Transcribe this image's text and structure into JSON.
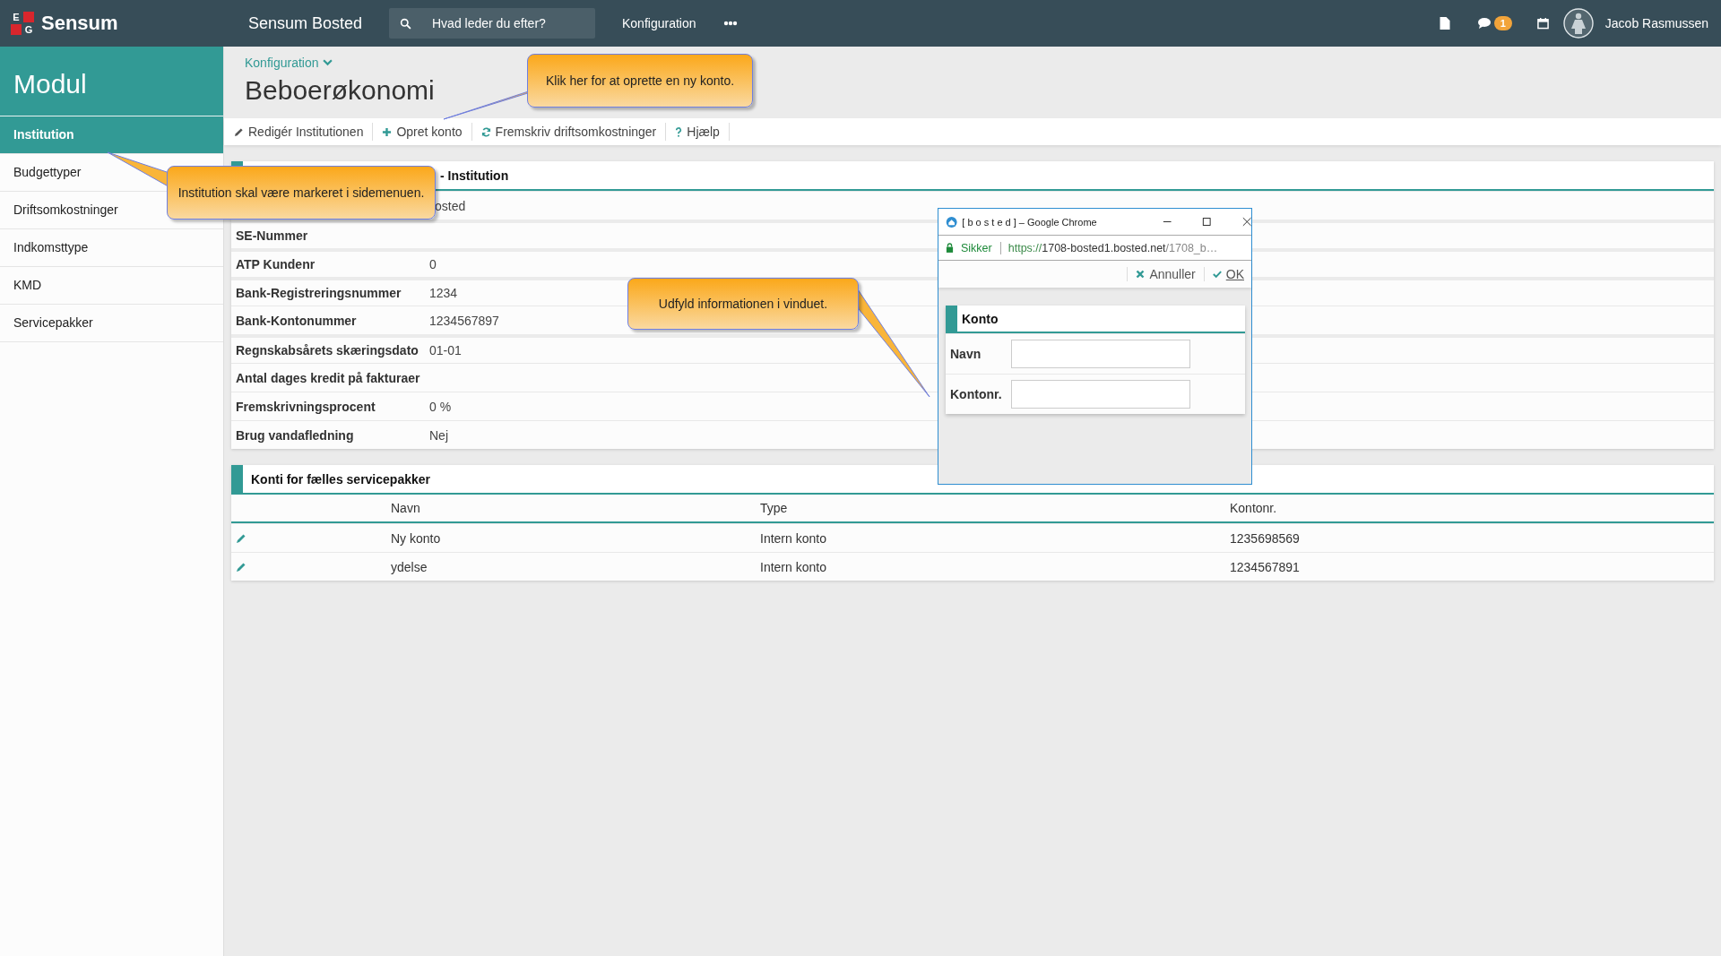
{
  "topbar": {
    "logo": {
      "letters": [
        "E",
        "G"
      ],
      "name": "Sensum"
    },
    "app_title": "Sensum Bosted",
    "search": {
      "placeholder": "Hvad leder du efter?"
    },
    "menu": "Konfiguration",
    "messages_badge": "1",
    "user": "Jacob Rasmussen"
  },
  "sidebar": {
    "title": "Modul",
    "items": [
      {
        "label": "Institution",
        "selected": true
      },
      {
        "label": "Budgettyper",
        "selected": false
      },
      {
        "label": "Driftsomkostninger",
        "selected": false
      },
      {
        "label": "Indkomsttype",
        "selected": false
      },
      {
        "label": "KMD",
        "selected": false
      },
      {
        "label": "Servicepakker",
        "selected": false
      }
    ]
  },
  "breadcrumb": "Konfiguration",
  "page_title": "Beboerøkonomi",
  "toolbar": [
    {
      "kind": "edit",
      "label": "Redigér Institutionen"
    },
    {
      "kind": "add",
      "label": "Opret konto"
    },
    {
      "kind": "refresh",
      "label": "Fremskriv driftsomkostninger"
    },
    {
      "kind": "help",
      "label": "Hjælp"
    }
  ],
  "details": {
    "title": "- Institution",
    "rows": [
      {
        "value": "osted"
      },
      {
        "label": "SE-Nummer"
      },
      {
        "label": "ATP Kundenr",
        "value": "0"
      },
      {
        "label": "Bank-Registreringsnummer",
        "value": "1234"
      },
      {
        "label": "Bank-Kontonummer",
        "value": "1234567897"
      },
      {
        "label": "Regnskabsårets skæringsdato",
        "value": "01-01"
      },
      {
        "label": "Antal dages kredit på fakturaer"
      },
      {
        "label": "Fremskrivningsprocent",
        "value": "0 %"
      },
      {
        "label": "Brug vandafledning",
        "value": "Nej"
      }
    ]
  },
  "accounts": {
    "title": "Konti for fælles servicepakker",
    "columns": [
      "Navn",
      "Type",
      "Kontonr."
    ],
    "rows": [
      [
        "Ny konto",
        "Intern konto",
        "1235698569"
      ],
      [
        "ydelse",
        "Intern konto",
        "1234567891"
      ]
    ]
  },
  "popup": {
    "window_title": "[ b o s t e d ] – Google Chrome",
    "security": "Sikker",
    "url_scheme": "https://",
    "url_host": "1708-bosted1.bosted.net",
    "url_path": "/1708_b…",
    "cancel": "Annuller",
    "ok": "OK",
    "panel_title": "Konto",
    "fields": [
      {
        "label": "Navn"
      },
      {
        "label": "Kontonr."
      }
    ]
  },
  "callouts": [
    {
      "text": "Klik her for at oprette en ny konto."
    },
    {
      "text": "Institution skal være markeret i sidemenuen."
    },
    {
      "text": "Udfyld informationen i vinduet."
    }
  ]
}
